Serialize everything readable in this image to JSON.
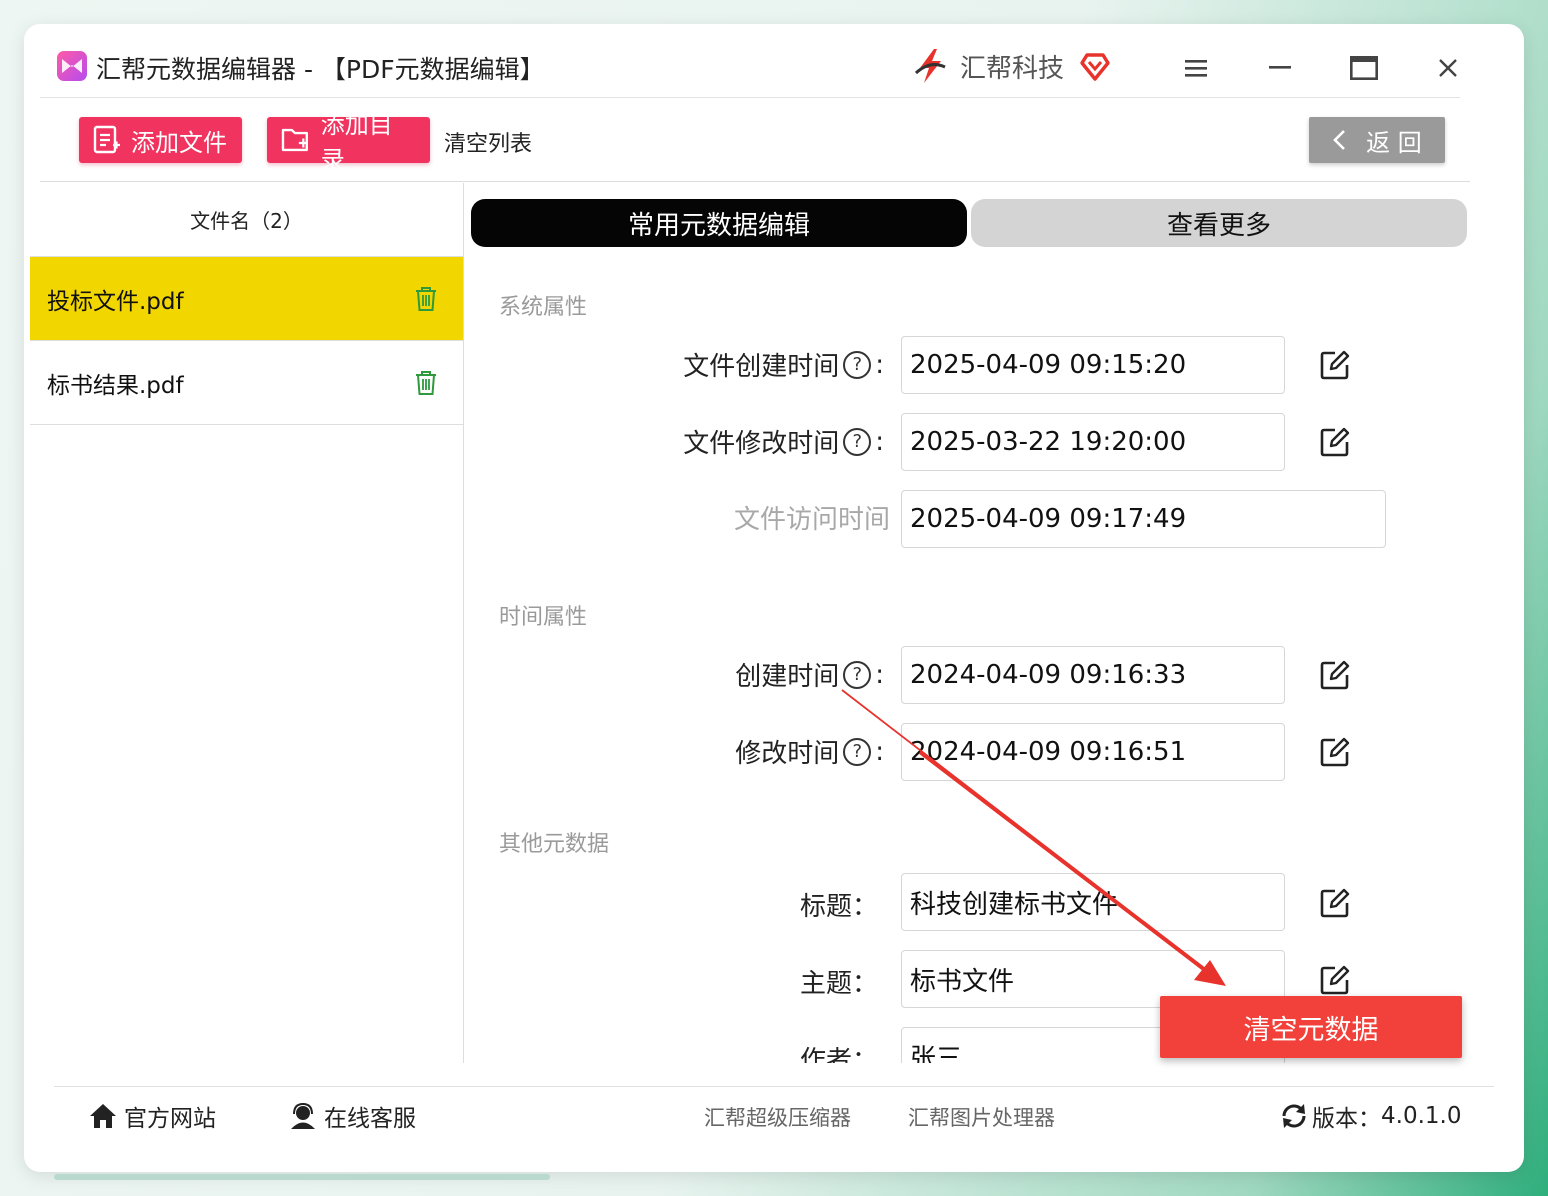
{
  "window": {
    "title": "汇帮元数据编辑器 - 【PDF元数据编辑】",
    "brand_name": "汇帮科技"
  },
  "toolbar": {
    "add_file_label": "添加文件",
    "add_folder_label": "添加目录",
    "clear_list_label": "清空列表",
    "back_label": "返 回"
  },
  "file_list": {
    "header": "文件名（2）",
    "files": [
      {
        "name": "投标文件.pdf",
        "selected": true
      },
      {
        "name": "标书结果.pdf",
        "selected": false
      }
    ]
  },
  "tabs": {
    "common_label": "常用元数据编辑",
    "more_label": "查看更多"
  },
  "system_props": {
    "section_label": "系统属性",
    "created_label": "文件创建时间",
    "created_value": "2025-04-09 09:15:20",
    "modified_label": "文件修改时间",
    "modified_value": "2025-03-22 19:20:00",
    "accessed_label": "文件访问时间",
    "accessed_value": "2025-04-09 09:17:49"
  },
  "time_props": {
    "section_label": "时间属性",
    "created_label": "创建时间",
    "created_value": "2024-04-09 09:16:33",
    "modified_label": "修改时间",
    "modified_value": "2024-04-09 09:16:51"
  },
  "other_meta": {
    "section_label": "其他元数据",
    "title_label": "标题：",
    "title_value": "科技创建标书文件",
    "subject_label": "主题：",
    "subject_value": "标书文件",
    "author_label": "作者：",
    "author_value": "张三"
  },
  "actions": {
    "clear_metadata_label": "清空元数据"
  },
  "footer": {
    "website_label": "官方网站",
    "support_label": "在线客服",
    "compressor_label": "汇帮超级压缩器",
    "image_tool_label": "汇帮图片处理器",
    "version_label": "版本：",
    "version_value": "4.0.1.0"
  },
  "colors": {
    "accent_pink": "#f0335f",
    "selected_row": "#f2d600",
    "clear_button": "#f2403a",
    "annotation_arrow": "#e8332c"
  }
}
